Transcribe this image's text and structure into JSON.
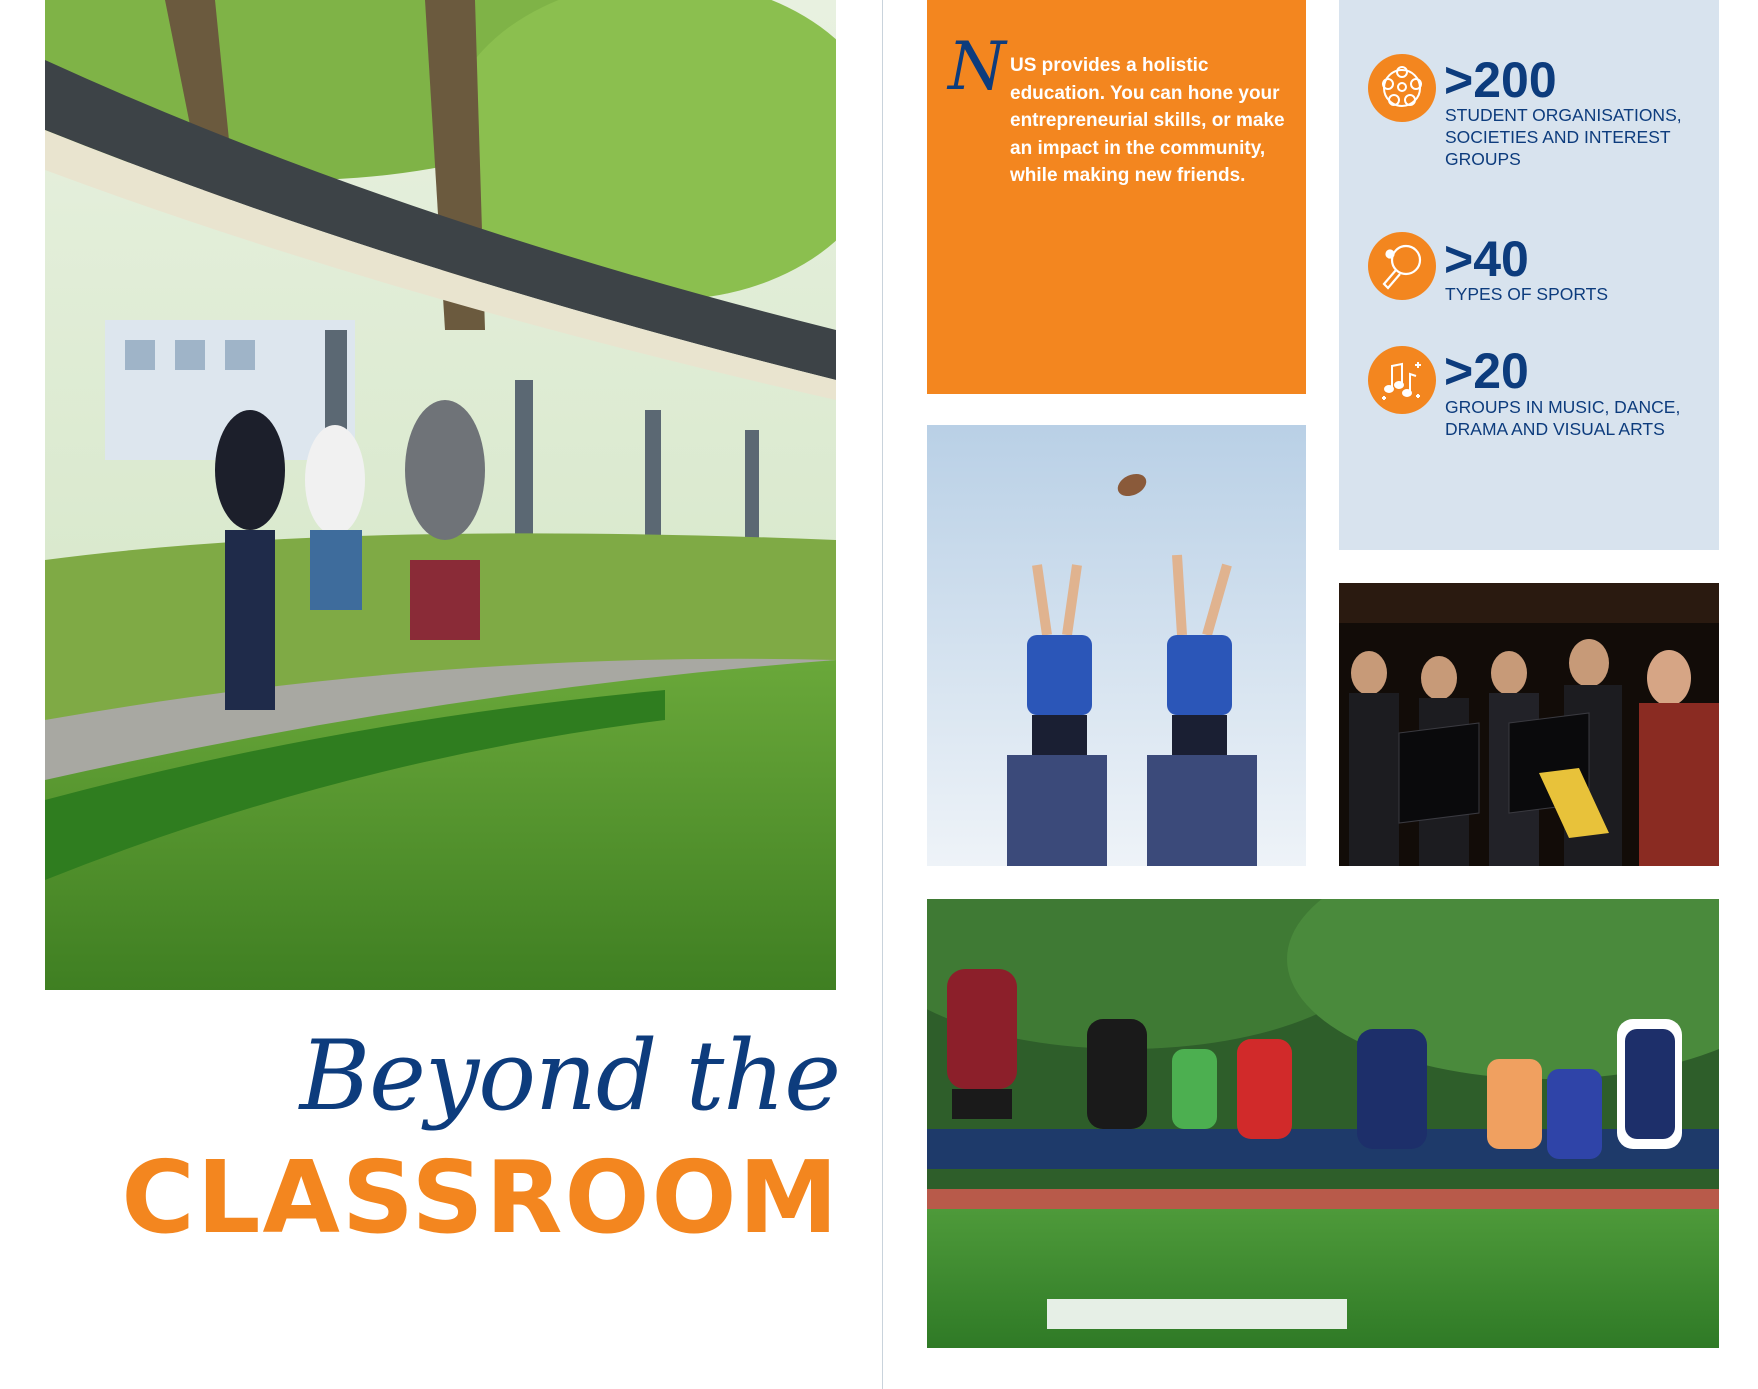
{
  "title": {
    "script_line": "Beyond the",
    "main_line": "CLASSROOM"
  },
  "intro": {
    "dropcap": "N",
    "text": "US provides a holistic education. You can hone your entrepreneurial skills, or make an impact in the community, while making new friends."
  },
  "stats": [
    {
      "value": ">200",
      "label": "STUDENT ORGANISATIONS, SOCIETIES AND INTEREST GROUPS",
      "icon": "people-network-icon"
    },
    {
      "value": ">40",
      "label": "TYPES OF SPORTS",
      "icon": "ping-pong-paddle-icon"
    },
    {
      "value": ">20",
      "label": "GROUPS IN MUSIC, DANCE, DRAMA AND VISUAL ARTS",
      "icon": "music-notes-icon"
    }
  ],
  "colors": {
    "accent_orange": "#f3861f",
    "brand_blue": "#0d3c7d",
    "stats_panel": "#d8e3ee"
  }
}
